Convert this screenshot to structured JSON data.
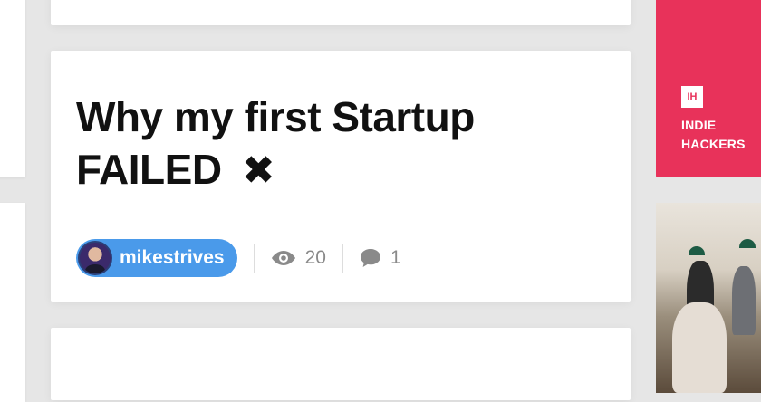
{
  "post": {
    "title": "Why my first Startup FAILED",
    "title_mark": "✖",
    "author": "mikestrives",
    "views": "20",
    "comments": "1"
  },
  "sponsor": {
    "logo_text": "IH",
    "name_line1": "INDIE",
    "name_line2": "HACKERS",
    "color": "#e8325a"
  },
  "colors": {
    "author_pill": "#4a9aea",
    "stat_text": "#8a8a8a"
  },
  "icons": {
    "views": "eye-icon",
    "comments": "comment-icon"
  }
}
